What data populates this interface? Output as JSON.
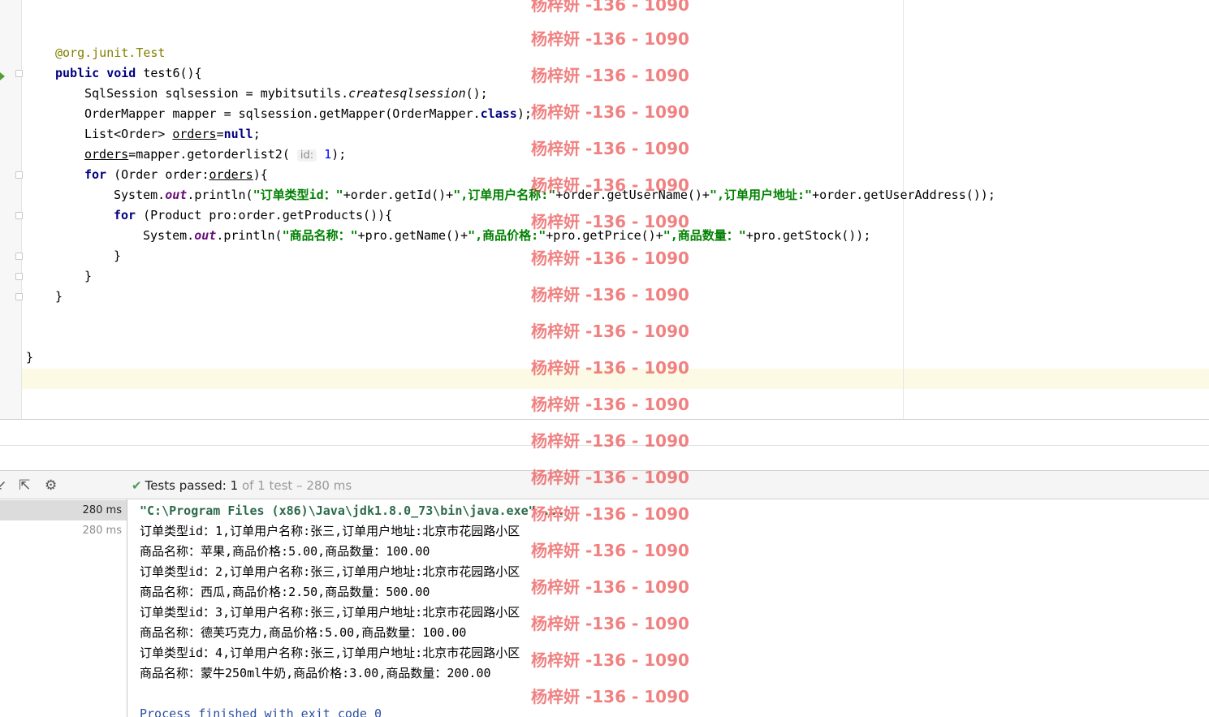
{
  "editor": {
    "code": {
      "l1_ann": "@org.junit.",
      "l1_ann2": "Test",
      "l2_kw1": "public",
      "l2_kw2": "void",
      "l2_rest": " test6(){",
      "l3_a": "SqlSession sqlsession = mybitsutils.",
      "l3_b": "createsqlsession",
      "l3_c": "();",
      "l4_a": "OrderMapper mapper = sqlsession.getMapper(OrderMapper.",
      "l4_kw": "class",
      "l4_c": ");",
      "l5_a": "List<Order> ",
      "l5_var": "orders",
      "l5_eq": "=",
      "l5_null": "null",
      "l5_end": ";",
      "l6_var": "orders",
      "l6_a": "=mapper.getorderlist2( ",
      "l6_hint": "id:",
      "l6_num": " 1",
      "l6_end": ");",
      "l7_kw": "for",
      "l7_a": " (Order order:",
      "l7_var": "orders",
      "l7_end": "){",
      "l8_a": "System.",
      "l8_field": "out",
      "l8_b": ".println(",
      "l8_s1": "\"订单类型id：\"",
      "l8_c": "+order.getId()+",
      "l8_s2": "\",订单用户名称:\"",
      "l8_d": "+order.getUserName()+",
      "l8_s3": "\",订单用户地址:\"",
      "l8_e": "+order.getUserAddress());",
      "l9_kw": "for",
      "l9_a": " (Product pro:order.getProducts()){",
      "l10_a": "System.",
      "l10_field": "out",
      "l10_b": ".println(",
      "l10_s1": "\"商品名称：\"",
      "l10_c": "+pro.getName()+",
      "l10_s2": "\",商品价格:\"",
      "l10_d": "+pro.getPrice()+",
      "l10_s3": "\",商品数量：\"",
      "l10_e": "+pro.getStock());",
      "l11": "}",
      "l12": "}",
      "l13": "}",
      "l14": "}"
    }
  },
  "toolbar": {
    "status_check": "✔",
    "status_passed": "Tests passed: 1",
    "status_rest": " of 1 test – 280 ms",
    "icon_down": "↙",
    "icon_export": "⇱",
    "icon_settings": "⚙"
  },
  "tree": {
    "rows": [
      {
        "time": "280 ms"
      },
      {
        "time": "280 ms"
      }
    ]
  },
  "console": {
    "lines": [
      "\"C:\\Program Files (x86)\\Java\\jdk1.8.0_73\\bin\\java.exe\" ...",
      "订单类型id：1,订单用户名称:张三,订单用户地址:北京市花园路小区",
      "商品名称：苹果,商品价格:5.00,商品数量：100.00",
      "订单类型id：2,订单用户名称:张三,订单用户地址:北京市花园路小区",
      "商品名称：西瓜,商品价格:2.50,商品数量：500.00",
      "订单类型id：3,订单用户名称:张三,订单用户地址:北京市花园路小区",
      "商品名称：德芙巧克力,商品价格:5.00,商品数量：100.00",
      "订单类型id：4,订单用户名称:张三,订单用户地址:北京市花园路小区",
      "商品名称：蒙牛250ml牛奶,商品价格:3.00,商品数量：200.00",
      "",
      "Process finished with exit code 0"
    ]
  },
  "watermark": {
    "text": "杨梓妍 -136 - 1090"
  }
}
